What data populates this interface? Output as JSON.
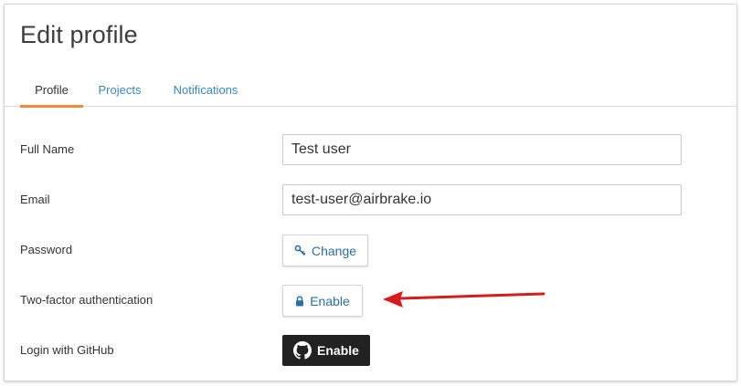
{
  "page": {
    "title": "Edit profile"
  },
  "tabs": [
    {
      "label": "Profile",
      "active": true
    },
    {
      "label": "Projects",
      "active": false
    },
    {
      "label": "Notifications",
      "active": false
    }
  ],
  "form": {
    "full_name": {
      "label": "Full Name",
      "value": "Test user"
    },
    "email": {
      "label": "Email",
      "value": "test-user@airbrake.io"
    },
    "password": {
      "label": "Password",
      "button_label": "Change",
      "button_icon": "key-icon"
    },
    "two_factor": {
      "label": "Two-factor authentication",
      "button_label": "Enable",
      "button_icon": "lock-icon"
    },
    "github": {
      "label": "Login with GitHub",
      "button_label": "Enable",
      "button_icon": "github-icon"
    }
  },
  "colors": {
    "accent_tab_underline": "#f0883e",
    "link_blue": "#3a87b8",
    "annotation_arrow": "#d41e1e",
    "github_button_bg": "#222222"
  }
}
